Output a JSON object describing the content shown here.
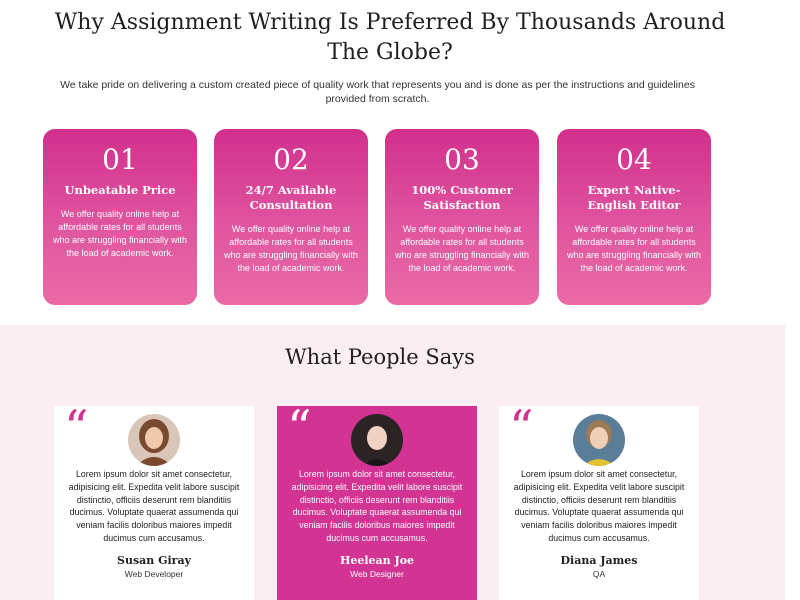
{
  "why": {
    "title": "Why Assignment Writing Is Preferred By Thousands Around The Globe?",
    "subtitle": "We take pride on delivering a custom created piece of quality work that represents you and is done as per the instructions and guidelines provided from scratch."
  },
  "cards": [
    {
      "num": "01",
      "title": "Unbeatable Price",
      "text": "We offer quality online help at affordable rates for all students who are struggling financially with the load of academic work."
    },
    {
      "num": "02",
      "title": "24/7 Available Consultation",
      "text": "We offer quality online help at affordable rates for all students who are struggling financially with the load of academic work."
    },
    {
      "num": "03",
      "title": "100% Customer Satisfaction",
      "text": "We offer quality online help at affordable rates for all students who are struggling financially with the load of academic work."
    },
    {
      "num": "04",
      "title": "Expert Native-English Editor",
      "text": "We offer quality online help at affordable rates for all students who are struggling financially with the load of academic work."
    }
  ],
  "people": {
    "title": "What People Says",
    "testimonials": [
      {
        "text": "Lorem ipsum dolor sit amet consectetur, adipisicing elit. Expedita velit labore suscipit distinctio, officiis deserunt rem blanditiis ducimus. Voluptate quaerat assumenda qui veniam facilis doloribus maiores impedit ducimus cum accusamus.",
        "name": "Susan Giray",
        "role": "Web Developer",
        "icon": "quote-icon"
      },
      {
        "text": "Lorem ipsum dolor sit amet consectetur, adipisicing elit. Expedita velit labore suscipit distinctio, officiis deserunt rem blanditiis ducimus. Voluptate quaerat assumenda qui veniam facilis doloribus maiores impedit ducimus cum accusamus.",
        "name": "Heelean Joe",
        "role": "Web Designer",
        "icon": "quote-icon"
      },
      {
        "text": "Lorem ipsum dolor sit amet consectetur, adipisicing elit. Expedita velit labore suscipit distinctio, officiis deserunt rem blanditiis ducimus. Voluptate quaerat assumenda qui veniam facilis doloribus maiores impedit ducimus cum accusamus.",
        "name": "Diana James",
        "role": "QA",
        "icon": "quote-icon"
      }
    ]
  },
  "colors": {
    "accent": "#d33392",
    "section_bg": "#fbeef3"
  }
}
